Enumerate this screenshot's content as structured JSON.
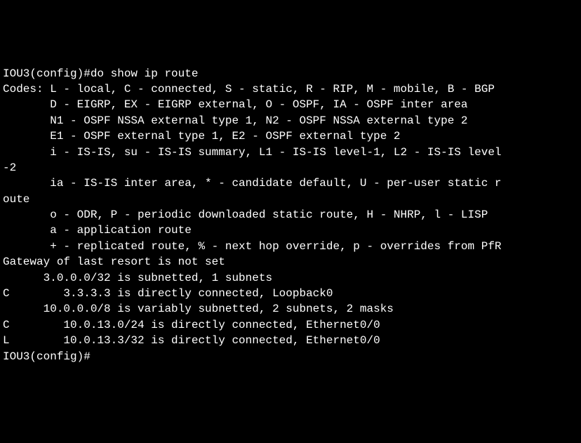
{
  "terminal": {
    "lines": [
      "IOU3(config)#do show ip route",
      "Codes: L - local, C - connected, S - static, R - RIP, M - mobile, B - BGP",
      "       D - EIGRP, EX - EIGRP external, O - OSPF, IA - OSPF inter area",
      "       N1 - OSPF NSSA external type 1, N2 - OSPF NSSA external type 2",
      "       E1 - OSPF external type 1, E2 - OSPF external type 2",
      "       i - IS-IS, su - IS-IS summary, L1 - IS-IS level-1, L2 - IS-IS level",
      "-2",
      "       ia - IS-IS inter area, * - candidate default, U - per-user static r",
      "oute",
      "       o - ODR, P - periodic downloaded static route, H - NHRP, l - LISP",
      "       a - application route",
      "       + - replicated route, % - next hop override, p - overrides from PfR",
      "",
      "Gateway of last resort is not set",
      "",
      "      3.0.0.0/32 is subnetted, 1 subnets",
      "C        3.3.3.3 is directly connected, Loopback0",
      "      10.0.0.0/8 is variably subnetted, 2 subnets, 2 masks",
      "C        10.0.13.0/24 is directly connected, Ethernet0/0",
      "L        10.0.13.3/32 is directly connected, Ethernet0/0",
      "IOU3(config)#"
    ]
  }
}
